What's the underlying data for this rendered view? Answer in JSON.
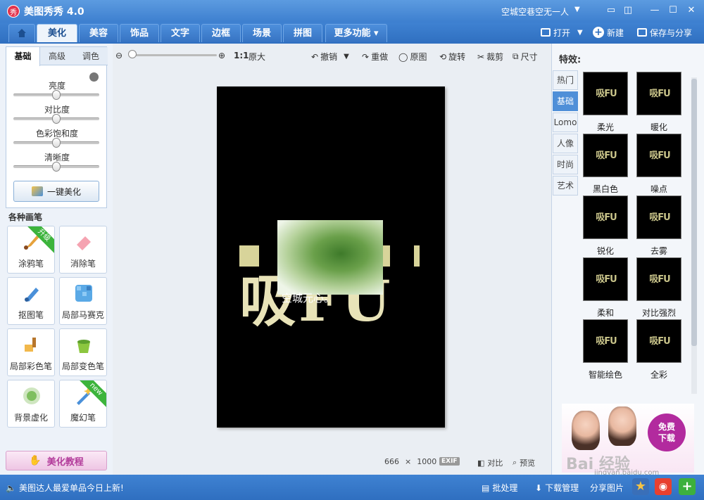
{
  "window": {
    "title": "美图秀秀 4.0",
    "user": "空城空巷空无一人",
    "logo_text": "秀"
  },
  "tabs": [
    "美化",
    "美容",
    "饰品",
    "文字",
    "边框",
    "场景",
    "拼图",
    "更多功能"
  ],
  "top_actions": {
    "open": "打开",
    "new": "新建",
    "save_share": "保存与分享"
  },
  "left": {
    "subtabs": [
      "基础",
      "高级",
      "调色"
    ],
    "sliders": [
      {
        "label": "亮度",
        "value": 0.5
      },
      {
        "label": "对比度",
        "value": 0.5
      },
      {
        "label": "色彩饱和度",
        "value": 0.5
      },
      {
        "label": "清晰度",
        "value": 0.5
      }
    ],
    "one_key": "一键美化",
    "brushes_title": "各种画笔",
    "brushes": [
      {
        "label": "涂鸦笔",
        "badge": "升级"
      },
      {
        "label": "消除笔",
        "badge": ""
      },
      {
        "label": "抠图笔",
        "badge": ""
      },
      {
        "label": "局部马赛克",
        "badge": ""
      },
      {
        "label": "局部彩色笔",
        "badge": ""
      },
      {
        "label": "局部变色笔",
        "badge": ""
      },
      {
        "label": "背景虚化",
        "badge": ""
      },
      {
        "label": "魔幻笔",
        "badge": "new"
      }
    ],
    "tutorial": "美化教程"
  },
  "canvas": {
    "ratio": "1:1",
    "original_size": "原大",
    "undo": "撤销",
    "redo": "重做",
    "original": "原图",
    "rotate": "旋转",
    "crop": "裁剪",
    "resize": "尺寸",
    "image_text": "空城元心。",
    "image_big": "吸FU",
    "dimensions": {
      "w": "666",
      "sep": "×",
      "h": "1000"
    },
    "exif": "EXIF",
    "compare": "对比",
    "preview": "预览"
  },
  "right": {
    "title": "特效:",
    "tabs": [
      "热门",
      "基础",
      "Lomo",
      "人像",
      "时尚",
      "艺术"
    ],
    "active_tab": 1,
    "effects": [
      "柔光",
      "暖化",
      "黑白色",
      "噪点",
      "锐化",
      "去雾",
      "柔和",
      "对比强烈",
      "智能绘色",
      "全彩"
    ],
    "effect_thumb_text": "吸FU",
    "ad": {
      "button": "免费\n下载",
      "watermark": "Bai 经验",
      "url": "jingyan.baidu.com"
    }
  },
  "status": {
    "news": "美图达人最爱单品今日上新!",
    "batch": "批处理",
    "download_mgr": "下载管理",
    "share_image": "分享图片"
  },
  "colors": {
    "accent": "#3f82d2",
    "title_bar": "#5c9be0",
    "brand_red": "#e2344d",
    "pink": "#b22a9e",
    "green_badge": "#3cb43c"
  }
}
